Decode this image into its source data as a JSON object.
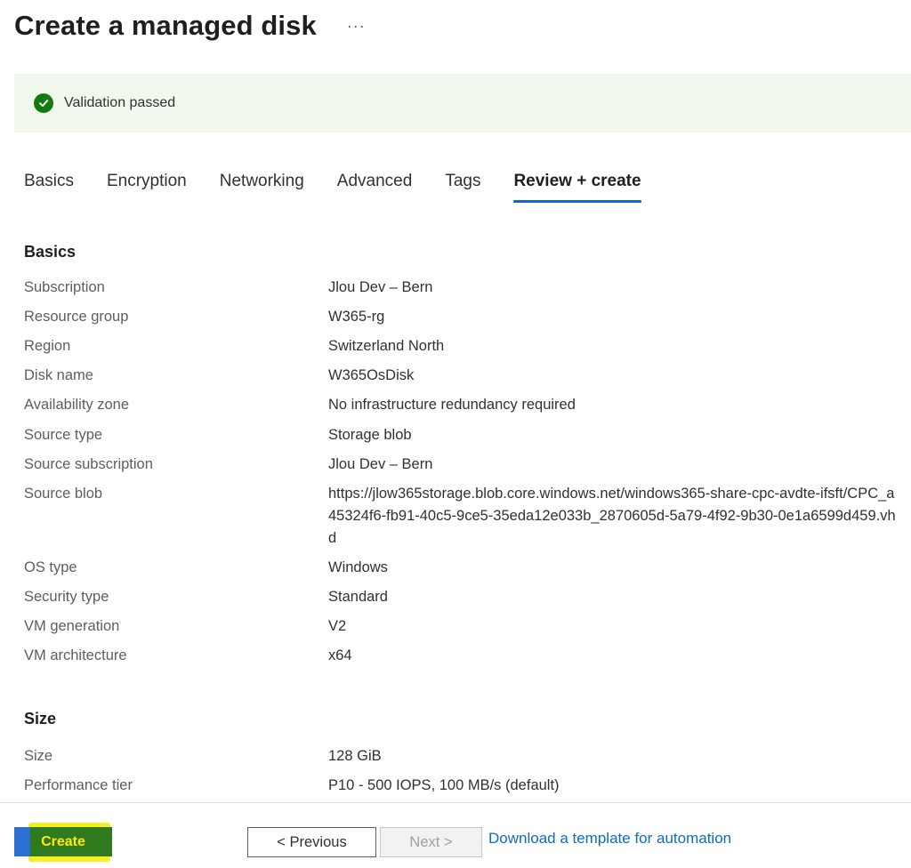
{
  "header": {
    "title": "Create a managed disk",
    "more_label": "···"
  },
  "banner": {
    "text": "Validation passed",
    "icon": "checkmark-circle-icon",
    "color": "#107c10"
  },
  "tabs": [
    {
      "label": "Basics"
    },
    {
      "label": "Encryption"
    },
    {
      "label": "Networking"
    },
    {
      "label": "Advanced"
    },
    {
      "label": "Tags"
    },
    {
      "label": "Review + create",
      "active": true
    }
  ],
  "basics": {
    "title": "Basics",
    "rows": [
      {
        "label": "Subscription",
        "value": "Jlou Dev – Bern"
      },
      {
        "label": "Resource group",
        "value": "W365-rg"
      },
      {
        "label": "Region",
        "value": "Switzerland North"
      },
      {
        "label": "Disk name",
        "value": "W365OsDisk"
      },
      {
        "label": "Availability zone",
        "value": "No infrastructure redundancy required"
      },
      {
        "label": "Source type",
        "value": "Storage blob"
      },
      {
        "label": "Source subscription",
        "value": "Jlou Dev – Bern"
      },
      {
        "label": "Source blob",
        "value": "https://jlow365storage.blob.core.windows.net/windows365-share-cpc-avdte-ifsft/CPC_a45324f6-fb91-40c5-9ce5-35eda12e033b_2870605d-5a79-4f92-9b30-0e1a6599d459.vhd"
      },
      {
        "label": "OS type",
        "value": "Windows"
      },
      {
        "label": "Security type",
        "value": "Standard"
      },
      {
        "label": "VM generation",
        "value": "V2"
      },
      {
        "label": "VM architecture",
        "value": "x64"
      }
    ]
  },
  "size": {
    "title": "Size",
    "rows": [
      {
        "label": "Size",
        "value": "128 GiB"
      },
      {
        "label": "Performance tier",
        "value": "P10 - 500 IOPS, 100 MB/s (default)"
      }
    ]
  },
  "footer": {
    "create_label": "Create",
    "previous_label": "< Previous",
    "next_label": "Next >",
    "download_label": "Download a template for automation"
  },
  "colors": {
    "accent": "#0f6cbd",
    "success": "#107c10",
    "highlight": "#f5ef1e"
  }
}
